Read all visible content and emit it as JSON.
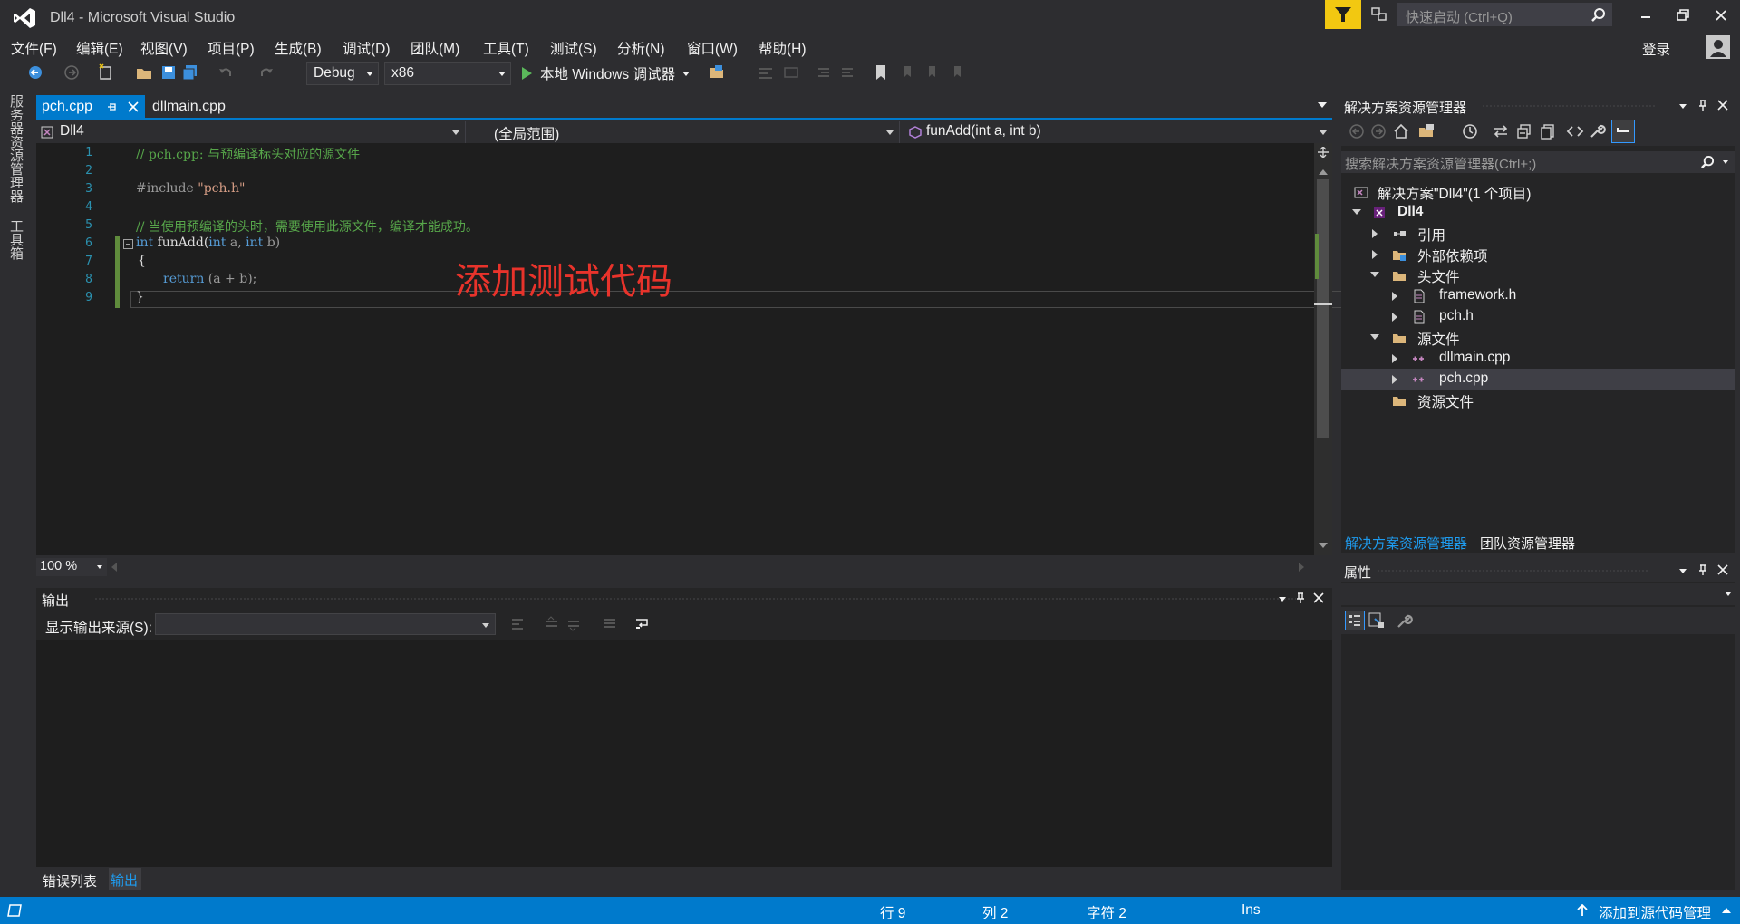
{
  "window": {
    "title": "Dll4 - Microsoft Visual Studio",
    "quick_launch_placeholder": "快速启动 (Ctrl+Q)",
    "login_label": "登录"
  },
  "menu": [
    "文件(F)",
    "编辑(E)",
    "视图(V)",
    "项目(P)",
    "生成(B)",
    "调试(D)",
    "团队(M)",
    "工具(T)",
    "测试(S)",
    "分析(N)",
    "窗口(W)",
    "帮助(H)"
  ],
  "toolbar": {
    "configuration": "Debug",
    "platform": "x86",
    "run_label": "本地 Windows 调试器"
  },
  "left_tabs": [
    "服务器资源管理器",
    "工具箱"
  ],
  "document_tabs": [
    {
      "label": "pch.cpp",
      "active": true
    },
    {
      "label": "dllmain.cpp",
      "active": false
    }
  ],
  "navbar": {
    "project": "Dll4",
    "scope": "(全局范围)",
    "member": "funAdd(int a, int b)"
  },
  "editor": {
    "line_numbers": [
      "1",
      "2",
      "3",
      "4",
      "5",
      "6",
      "7",
      "8",
      "9"
    ],
    "lines": {
      "l1": "// pch.cpp: 与预编译标头对应的源文件",
      "l3_directive": "#include ",
      "l3_string": "\"pch.h\"",
      "l5": "// 当使用预编译的头时，需要使用此源文件，编译才能成功。",
      "l6_kw": "int",
      "l6_name": " funAdd(",
      "l6_kw2": "int",
      "l6_a": " a, ",
      "l6_kw3": "int",
      "l6_b": " b)",
      "l7": "{",
      "l8_kw": "return",
      "l8_rest": " (a + b);",
      "l9": "}"
    },
    "annotation": "添加测试代码",
    "zoom": "100 %",
    "colors": {
      "comment": "#57a64a",
      "keyword": "#569cd6",
      "string": "#d69d85",
      "annotation": "#e8332b"
    }
  },
  "output": {
    "title": "输出",
    "source_label": "显示输出来源(S):",
    "source_value": ""
  },
  "bottom_tabs": [
    {
      "label": "错误列表",
      "active": false
    },
    {
      "label": "输出",
      "active": true
    }
  ],
  "solution_explorer": {
    "title": "解决方案资源管理器",
    "search_placeholder": "搜索解决方案资源管理器(Ctrl+;)",
    "items": [
      {
        "label": "解决方案\"Dll4\"(1 个项目)",
        "icon": "solution-icon"
      },
      {
        "label": "Dll4",
        "icon": "project-icon"
      },
      {
        "label": "引用",
        "icon": "references-icon"
      },
      {
        "label": "外部依赖项",
        "icon": "external-deps-icon"
      },
      {
        "label": "头文件",
        "icon": "folder-icon"
      },
      {
        "label": "framework.h",
        "icon": "header-file-icon"
      },
      {
        "label": "pch.h",
        "icon": "header-file-icon"
      },
      {
        "label": "源文件",
        "icon": "folder-icon"
      },
      {
        "label": "dllmain.cpp",
        "icon": "cpp-file-icon"
      },
      {
        "label": "pch.cpp",
        "icon": "cpp-file-icon",
        "selected": true
      },
      {
        "label": "资源文件",
        "icon": "folder-icon"
      }
    ],
    "tabs": [
      {
        "label": "解决方案资源管理器",
        "active": true
      },
      {
        "label": "团队资源管理器",
        "active": false
      }
    ]
  },
  "properties": {
    "title": "属性"
  },
  "statusbar": {
    "line": "行 9",
    "column": "列 2",
    "char": "字符 2",
    "mode": "Ins",
    "source_control": "添加到源代码管理"
  }
}
